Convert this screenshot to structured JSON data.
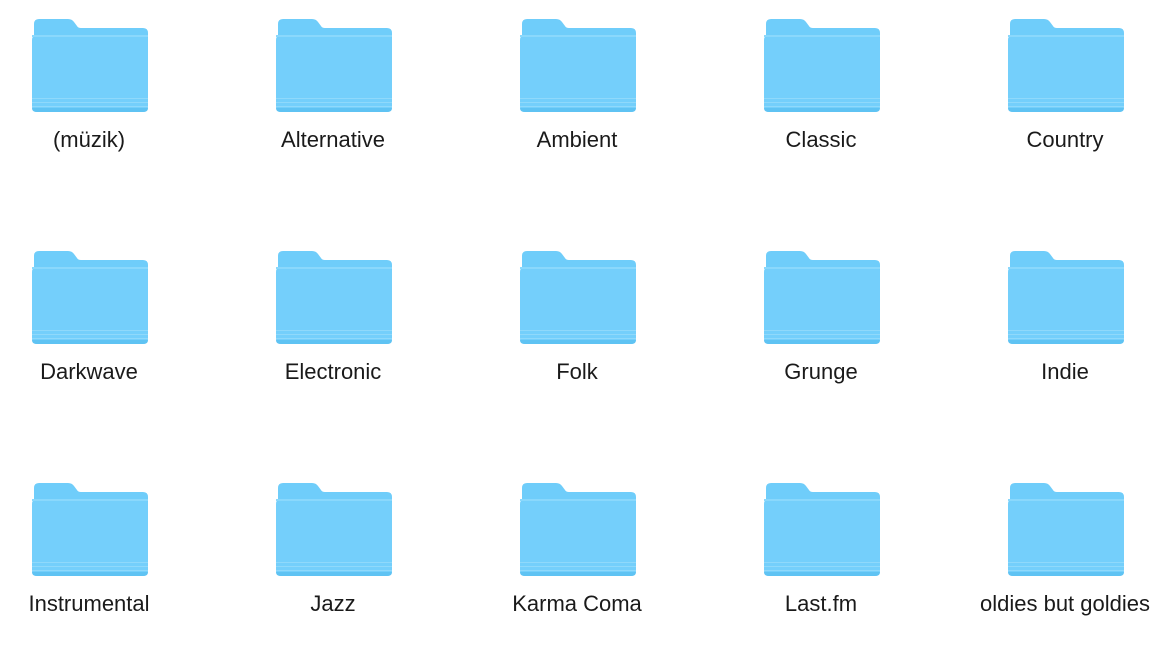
{
  "window": {
    "view": "icon-grid"
  },
  "colors": {
    "folder_back": "#5cc2f5",
    "folder_tab": "#6fcdfa",
    "folder_front": "#74cffb",
    "folder_bottom": "#5fc3f3",
    "label_text": "#1a1a1a",
    "background": "#ffffff"
  },
  "folders": [
    {
      "name": "(müzik)",
      "icon": "folder-icon"
    },
    {
      "name": "Alternative",
      "icon": "folder-icon"
    },
    {
      "name": "Ambient",
      "icon": "folder-icon"
    },
    {
      "name": "Classic",
      "icon": "folder-icon"
    },
    {
      "name": "Country",
      "icon": "folder-icon"
    },
    {
      "name": "Darkwave",
      "icon": "folder-icon"
    },
    {
      "name": "Electronic",
      "icon": "folder-icon"
    },
    {
      "name": "Folk",
      "icon": "folder-icon"
    },
    {
      "name": "Grunge",
      "icon": "folder-icon"
    },
    {
      "name": "Indie",
      "icon": "folder-icon"
    },
    {
      "name": "Instrumental",
      "icon": "folder-icon"
    },
    {
      "name": "Jazz",
      "icon": "folder-icon"
    },
    {
      "name": "Karma Coma",
      "icon": "folder-icon"
    },
    {
      "name": "Last.fm",
      "icon": "folder-icon"
    },
    {
      "name": "oldies but goldies",
      "icon": "folder-icon"
    }
  ]
}
